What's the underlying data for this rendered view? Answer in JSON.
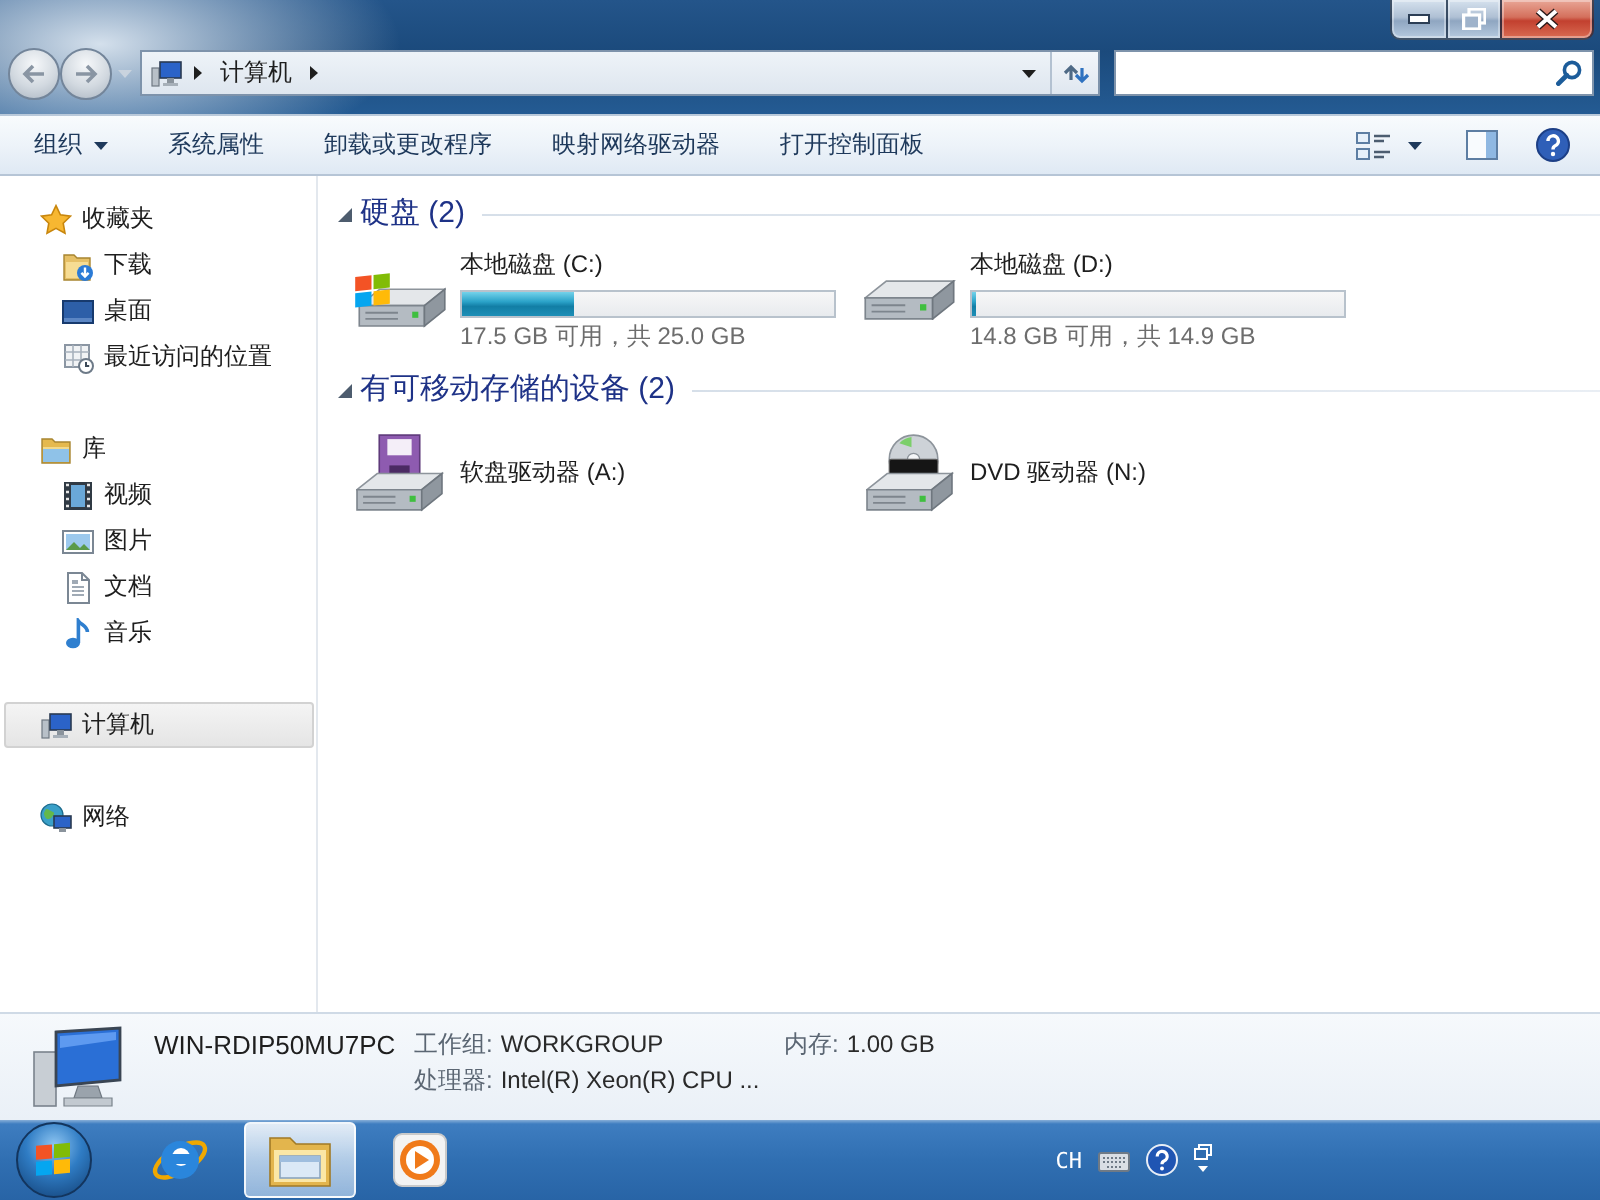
{
  "address_bar": {
    "path": [
      {
        "label": "计算机"
      }
    ]
  },
  "toolbar": {
    "items": [
      {
        "label": "组织",
        "kind": "menu"
      },
      {
        "label": "系统属性",
        "kind": "command"
      },
      {
        "label": "卸载或更改程序",
        "kind": "command"
      },
      {
        "label": "映射网络驱动器",
        "kind": "command"
      },
      {
        "label": "打开控制面板",
        "kind": "command"
      }
    ]
  },
  "sidebar": {
    "groups": [
      {
        "label": "收藏夹",
        "kind": "favorites",
        "selected": false,
        "children": [
          {
            "label": "下载",
            "kind": "downloads",
            "selected": false
          },
          {
            "label": "桌面",
            "kind": "desktop",
            "selected": false
          },
          {
            "label": "最近访问的位置",
            "kind": "recent",
            "selected": false
          }
        ]
      },
      {
        "label": "库",
        "kind": "libraries",
        "selected": false,
        "children": [
          {
            "label": "视频",
            "kind": "videos",
            "selected": false
          },
          {
            "label": "图片",
            "kind": "pictures",
            "selected": false
          },
          {
            "label": "文档",
            "kind": "documents",
            "selected": false
          },
          {
            "label": "音乐",
            "kind": "music",
            "selected": false
          }
        ]
      },
      {
        "label": "计算机",
        "kind": "computer",
        "selected": true
      },
      {
        "label": "网络",
        "kind": "network",
        "selected": false
      }
    ]
  },
  "sections": [
    {
      "title": "硬盘 (2)",
      "expanded": true,
      "items": [
        {
          "name": "本地磁盘 (C:)",
          "kind": "system_disk",
          "level": 0.3,
          "reading": "17.5 GB 可用，共 25.0 GB"
        },
        {
          "name": "本地磁盘 (D:)",
          "kind": "disk",
          "level": 0.01,
          "reading": "14.8 GB 可用，共 14.9 GB"
        }
      ]
    },
    {
      "title": "有可移动存储的设备 (2)",
      "expanded": true,
      "items": [
        {
          "name": "软盘驱动器 (A:)",
          "kind": "floppy"
        },
        {
          "name": "DVD 驱动器 (N:)",
          "kind": "dvd"
        }
      ]
    }
  ],
  "details": {
    "name": "WIN-RDIP50MU7PC",
    "fields": [
      {
        "label": "工作组:",
        "value": "WORKGROUP"
      },
      {
        "label": "内存:",
        "value": "1.00 GB"
      },
      {
        "label": "处理器:",
        "value": "Intel(R) Xeon(R) CPU ..."
      }
    ]
  },
  "taskbar": {
    "apps": [
      {
        "kind": "browser",
        "selected": false
      },
      {
        "kind": "explorer",
        "selected": true
      },
      {
        "kind": "media_player",
        "selected": false
      }
    ],
    "tray": {
      "language": "CH"
    }
  }
}
